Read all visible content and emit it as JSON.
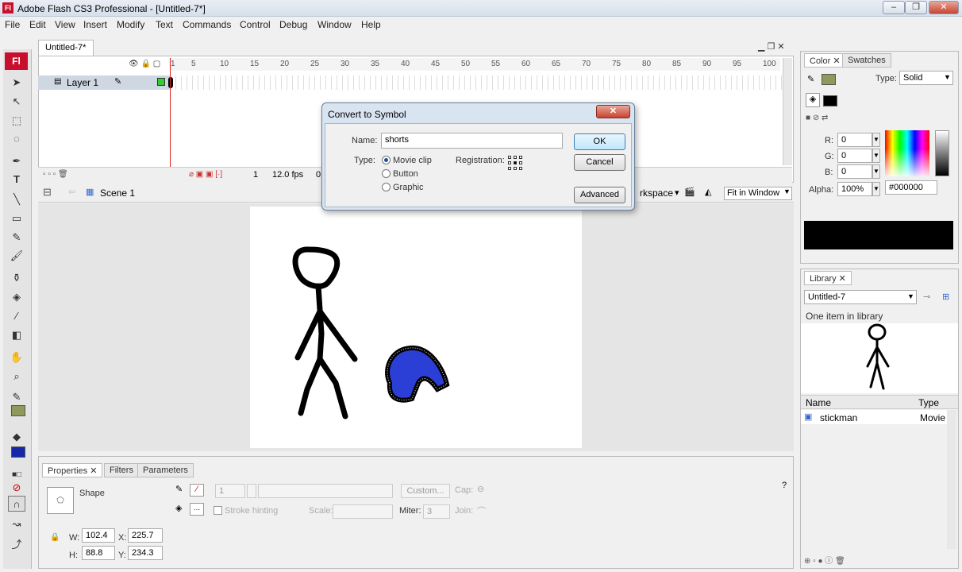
{
  "window": {
    "title": "Adobe Flash CS3 Professional - [Untitled-7*]"
  },
  "menu": [
    "File",
    "Edit",
    "View",
    "Insert",
    "Modify",
    "Text",
    "Commands",
    "Control",
    "Debug",
    "Window",
    "Help"
  ],
  "document": {
    "tab": "Untitled-7*"
  },
  "timeline": {
    "ticks": [
      "1",
      "5",
      "10",
      "15",
      "20",
      "25",
      "30",
      "35",
      "40",
      "45",
      "50",
      "55",
      "60",
      "65",
      "70",
      "75",
      "80",
      "85",
      "90",
      "95",
      "100"
    ],
    "layer": "Layer 1",
    "current_frame": "1",
    "fps": "12.0 fps",
    "elapsed": "0"
  },
  "scene": {
    "label": "Scene 1",
    "workspace": "Workspace",
    "zoom": "Fit in Window"
  },
  "dialog": {
    "title": "Convert to Symbol",
    "name_label": "Name:",
    "name_value": "shorts",
    "type_label": "Type:",
    "types": [
      "Movie clip",
      "Button",
      "Graphic"
    ],
    "selected_type": "Movie clip",
    "registration_label": "Registration:",
    "ok": "OK",
    "cancel": "Cancel",
    "advanced": "Advanced"
  },
  "properties": {
    "tabs": [
      "Properties",
      "Filters",
      "Parameters"
    ],
    "kind": "Shape",
    "stroke_height": "1",
    "custom_button": "Custom...",
    "cap_label": "Cap:",
    "stroke_hinting": "Stroke hinting",
    "scale_label": "Scale:",
    "miter_label": "Miter:",
    "miter_value": "3",
    "join_label": "Join:",
    "w_label": "W:",
    "w": "102.4",
    "x_label": "X:",
    "x": "225.7",
    "h_label": "H:",
    "h": "88.8",
    "y_label": "Y:",
    "y": "234.3"
  },
  "color_panel": {
    "tabs": [
      "Color",
      "Swatches"
    ],
    "type_label": "Type:",
    "type_value": "Solid",
    "r_label": "R:",
    "r": "0",
    "g_label": "G:",
    "g": "0",
    "b_label": "B:",
    "b": "0",
    "alpha_label": "Alpha:",
    "alpha": "100%",
    "hex": "#000000"
  },
  "library": {
    "tab": "Library",
    "document": "Untitled-7",
    "count_text": "One item in library",
    "col_name": "Name",
    "col_type": "Type",
    "items": [
      {
        "name": "stickman",
        "type": "Movie"
      }
    ]
  },
  "colors": {
    "fill": "#2b3fd6",
    "stroke": "#000000"
  }
}
